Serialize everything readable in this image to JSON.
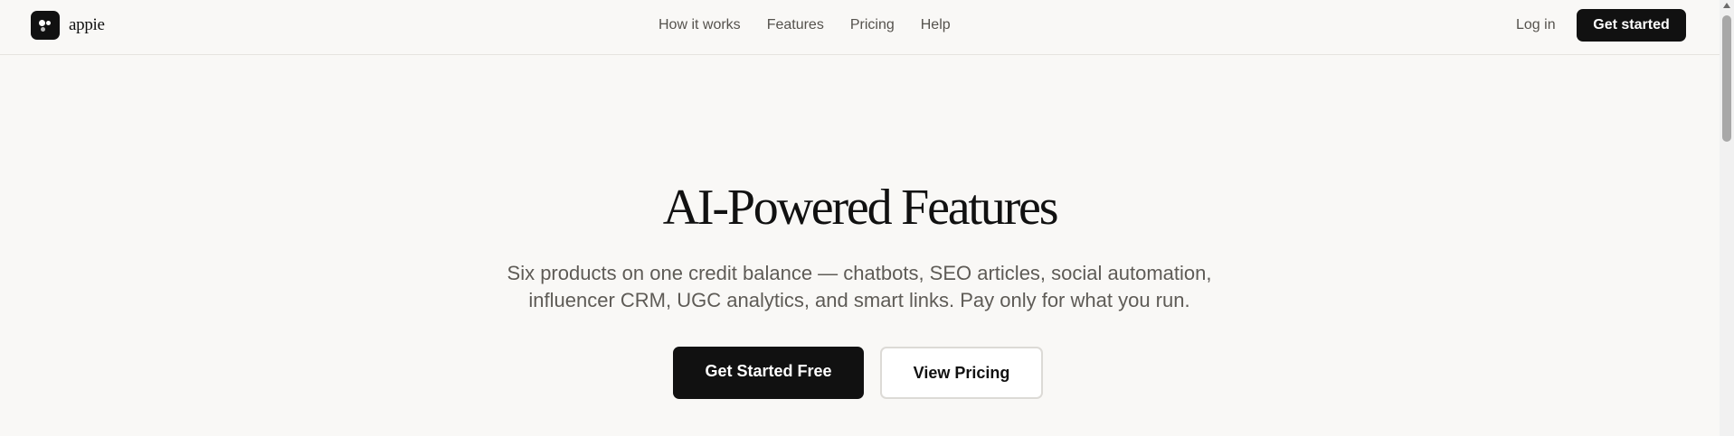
{
  "header": {
    "brand": "appie",
    "nav": [
      {
        "label": "How it works"
      },
      {
        "label": "Features"
      },
      {
        "label": "Pricing"
      },
      {
        "label": "Help"
      }
    ],
    "login_label": "Log in",
    "cta_label": "Get started"
  },
  "hero": {
    "title": "AI-Powered Features",
    "subtitle": "Six products on one credit balance — chatbots, SEO articles, social automation, influencer CRM, UGC analytics, and smart links. Pay only for what you run.",
    "primary_cta": "Get Started Free",
    "secondary_cta": "View Pricing"
  },
  "colors": {
    "background": "#f9f8f6",
    "primary": "#111111",
    "muted_text": "#5e5b56",
    "border": "#dcdad6"
  },
  "icons": {
    "logo": "appie-logo-icon"
  }
}
